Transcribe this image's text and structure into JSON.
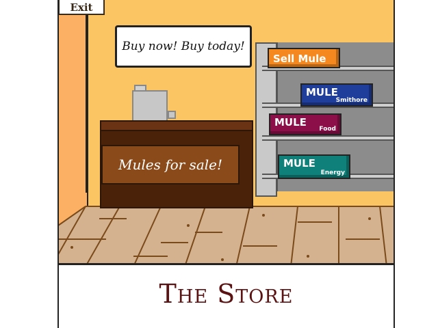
{
  "exit_label": "Exit",
  "sign_text": "Buy now! Buy today!",
  "counter_text": "Mules for sale!",
  "boxes": {
    "sell": {
      "main": "Sell Mule",
      "sub": ""
    },
    "smithore": {
      "main": "MULE",
      "sub": "Smithore"
    },
    "food": {
      "main": "MULE",
      "sub": "Food"
    },
    "energy": {
      "main": "MULE",
      "sub": "Energy"
    }
  },
  "title": "The Store",
  "colors": {
    "sell": "#f5881f",
    "smithore": "#1f3d9a",
    "food": "#8c0f4a",
    "energy": "#10807a",
    "title": "#5a1212"
  }
}
